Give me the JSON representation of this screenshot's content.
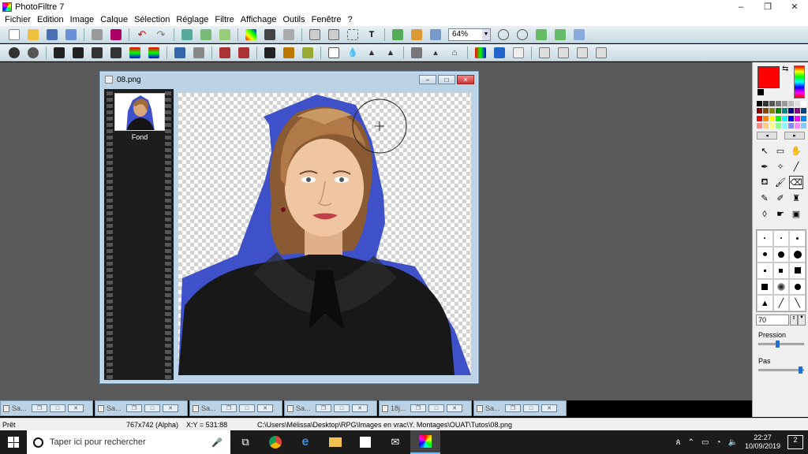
{
  "app": {
    "title": "PhotoFiltre 7"
  },
  "window_controls": {
    "minimize": "–",
    "maximize": "❐",
    "close": "✕"
  },
  "menu": [
    "Fichier",
    "Edition",
    "Image",
    "Calque",
    "Sélection",
    "Réglage",
    "Filtre",
    "Affichage",
    "Outils",
    "Fenêtre",
    "?"
  ],
  "toolbar": {
    "zoom_value": "64%"
  },
  "document": {
    "filename": "08.png",
    "layer_label": "Fond",
    "doc_buttons": [
      "–",
      "□",
      "✕"
    ]
  },
  "minimized_windows": [
    {
      "title": "Sa..."
    },
    {
      "title": "Sa..."
    },
    {
      "title": "Sa..."
    },
    {
      "title": "Sa..."
    },
    {
      "title": "18j..."
    },
    {
      "title": "Sa..."
    }
  ],
  "colors": {
    "foreground": "#ff0000",
    "background": "#ffffff",
    "selection_fill": "#3f51c8"
  },
  "right_panel": {
    "brush_size": "70",
    "pression_label": "Pression",
    "pas_label": "Pas",
    "pression_level": 0.4,
    "pas_level": 0.95
  },
  "status": {
    "state": "Prêt",
    "image_info": "767x742 (Alpha)",
    "coords": "X:Y = 531:88",
    "path": "C:\\Users\\Mélissa\\Desktop\\RPG\\Images en vrac\\Y. Montages\\OUAT\\Tutos\\08.png"
  },
  "taskbar": {
    "search_placeholder": "Taper ici pour rechercher",
    "time": "22:27",
    "date": "10/09/2019",
    "notification_count": "2"
  }
}
